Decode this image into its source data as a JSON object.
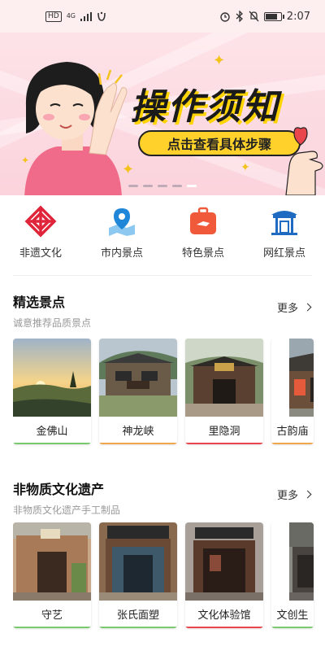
{
  "status_bar": {
    "hd": "HD",
    "network": "4G",
    "time": "2:07",
    "battery_level": 0.8
  },
  "banner": {
    "title": "操作须知",
    "subtitle": "点击查看具体步骤",
    "page_count": 5,
    "active_page": 4
  },
  "categories": [
    {
      "label": "非遗文化",
      "icon": "knot-icon",
      "color": "#e0243a"
    },
    {
      "label": "市内景点",
      "icon": "map-pin-icon",
      "color": "#1f86d8"
    },
    {
      "label": "特色景点",
      "icon": "suitcase-icon",
      "color": "#f05a3a"
    },
    {
      "label": "网红景点",
      "icon": "pavilion-icon",
      "color": "#1f6bc2"
    }
  ],
  "featured": {
    "title": "精选景点",
    "subtitle": "诚意推荐品质景点",
    "more": "更多",
    "items": [
      {
        "name": "金佛山",
        "bar_color": "#7bc96f"
      },
      {
        "name": "神龙峡",
        "bar_color": "#f0a64a"
      },
      {
        "name": "里隐洞",
        "bar_color": "#e8464c"
      },
      {
        "name": "古韵庙",
        "bar_color": "#f0a64a"
      }
    ]
  },
  "heritage": {
    "title": "非物质文化遗产",
    "subtitle": "非物质文化遗产手工制品",
    "more": "更多",
    "items": [
      {
        "name": "守艺",
        "bar_color": "#7bc96f"
      },
      {
        "name": "张氏面塑",
        "bar_color": "#7bc96f"
      },
      {
        "name": "文化体验馆",
        "bar_color": "#e8464c"
      },
      {
        "name": "文创生",
        "bar_color": "#7bc96f"
      }
    ]
  }
}
